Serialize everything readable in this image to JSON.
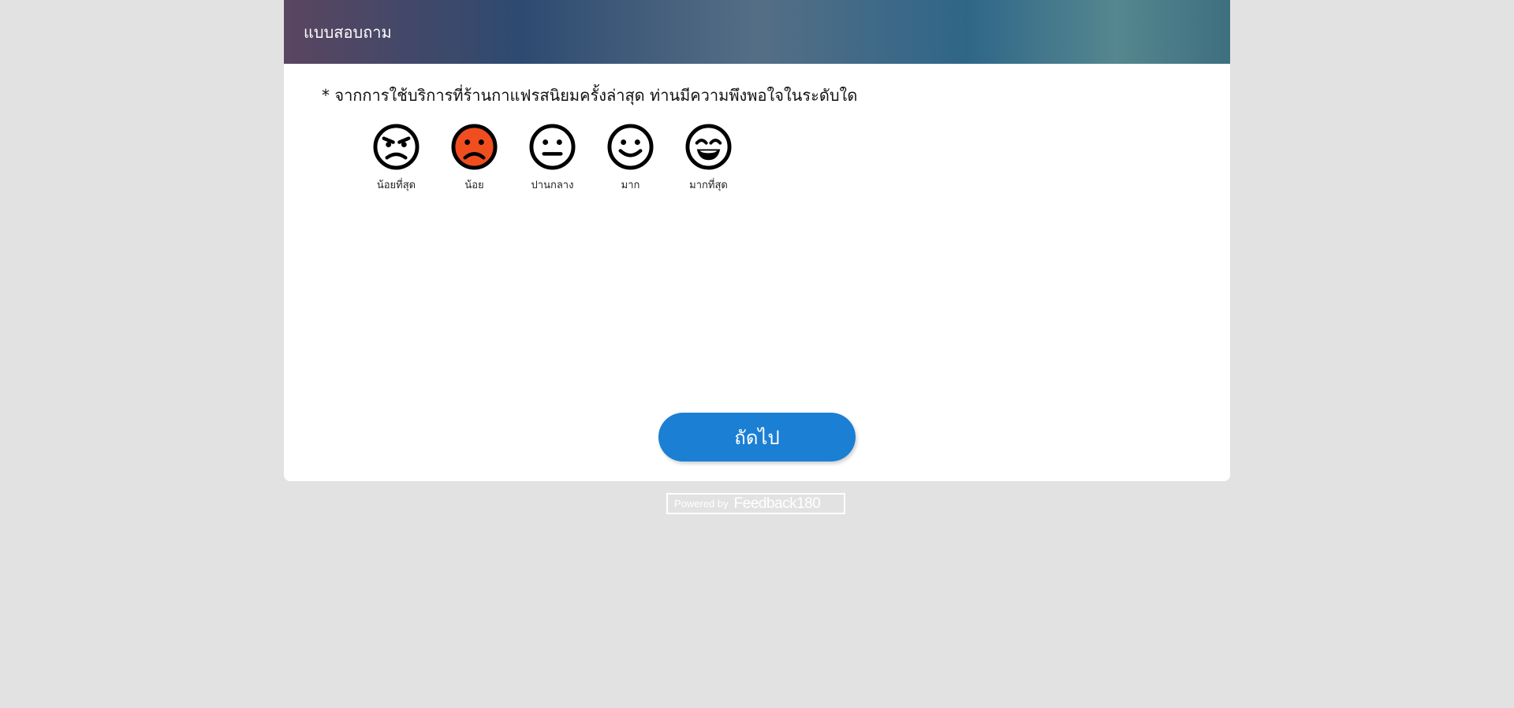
{
  "header": {
    "title": "แบบสอบถาม"
  },
  "question": {
    "text": "* จากการใช้บริการที่ร้านกาแฟรสนิยมครั้งล่าสุด ท่านมีความพึงพอใจในระดับใด"
  },
  "rating": {
    "selected_index": 1,
    "selected_color": "#f04e1e",
    "options": [
      {
        "label": "น้อยที่สุด",
        "icon": "angry-face-icon"
      },
      {
        "label": "น้อย",
        "icon": "frowning-face-icon"
      },
      {
        "label": "ปานกลาง",
        "icon": "neutral-face-icon"
      },
      {
        "label": "มาก",
        "icon": "smiling-face-icon"
      },
      {
        "label": "มากที่สุด",
        "icon": "grinning-face-icon"
      }
    ]
  },
  "footer": {
    "next_label": "ถัดไป",
    "next_color": "#1b7fd4",
    "powered_by": "Powered by",
    "brand": "Feedback180"
  }
}
